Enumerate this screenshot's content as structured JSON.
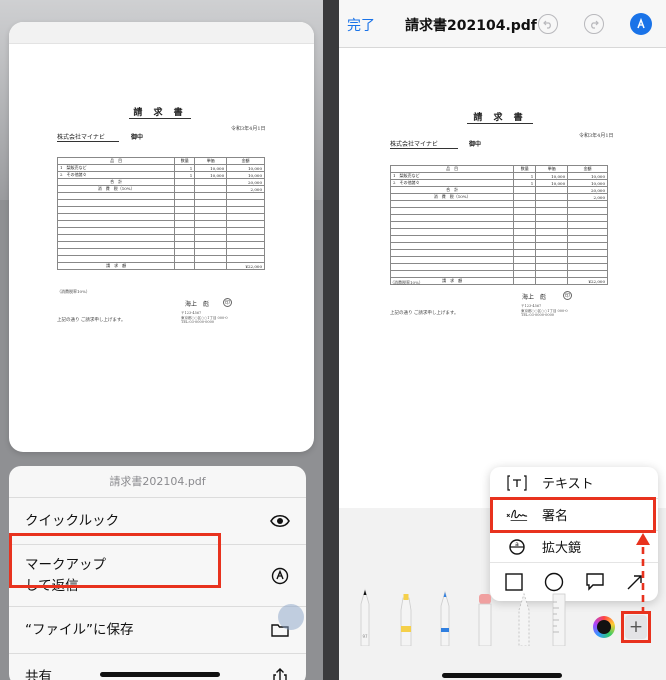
{
  "invoice": {
    "title": "請 求 書",
    "date": "令和3年4月1日",
    "client": "株式会社マイナビ",
    "honorific": "御中",
    "headers": [
      "品　目",
      "数量",
      "単価",
      "金額"
    ],
    "rows": [
      [
        "1　梨販売など",
        "1",
        "10,000",
        "10,000"
      ],
      [
        "2　その他諸々",
        "1",
        "10,000",
        "10,000"
      ]
    ],
    "subtotal_label": "合　計",
    "subtotal": "20,000",
    "tax_label": "消　費　税（10%）",
    "tax": "2,000",
    "total_label": "請　求　額",
    "total": "¥22,000",
    "note": "（消費税率10%）",
    "sender": "海上　彪",
    "stamp": "印",
    "address": [
      "〒123-4567",
      "東京都○○区○○1丁目 000-0",
      "TEL:03-0000-0000"
    ],
    "footer": "上記の通り ご請求申し上げます。"
  },
  "left": {
    "sheet_title": "請求書202104.pdf",
    "items": [
      {
        "label": "クイックルック",
        "icon": "eye-icon"
      },
      {
        "label": "マークアップ\nして返信",
        "icon": "markup-icon"
      },
      {
        "label": "“ファイル”に保存",
        "icon": "folder-icon"
      },
      {
        "label": "共有",
        "icon": "share-icon"
      }
    ]
  },
  "right": {
    "done": "完了",
    "title": "請求書202104.pdf",
    "popup": {
      "text": "テキスト",
      "signature": "署名",
      "magnifier": "拡大鏡"
    },
    "plus": "+"
  },
  "colors": {
    "accent": "#1a73e8",
    "highlight": "#e8321e"
  }
}
